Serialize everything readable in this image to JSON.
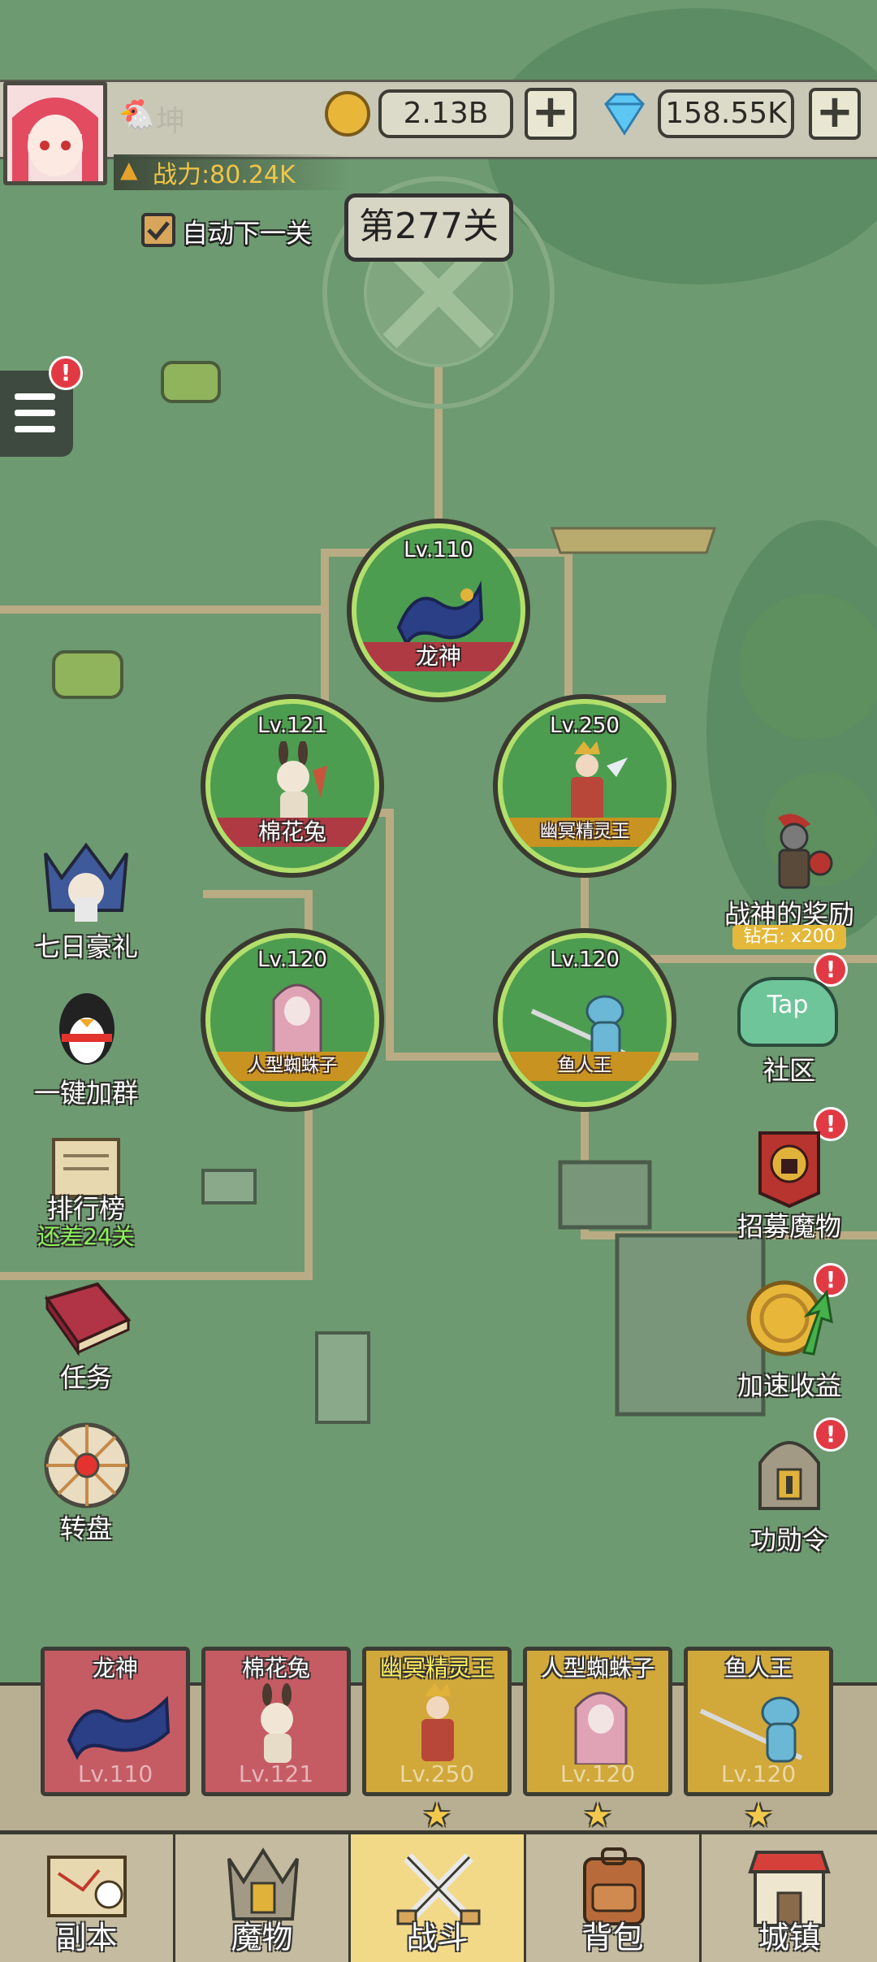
{
  "player": {
    "name": "坤",
    "power": "战力:80.24K",
    "gold": "2.13B",
    "diamonds": "158.55K"
  },
  "stage": {
    "auto_next_label": "自动下一关",
    "current": "第277关"
  },
  "formation": [
    {
      "level": "Lv.110",
      "name": "龙神",
      "banner": "red"
    },
    {
      "level": "Lv.121",
      "name": "棉花兔",
      "banner": "red"
    },
    {
      "level": "Lv.250",
      "name": "幽冥精灵王",
      "banner": "gold"
    },
    {
      "level": "Lv.120",
      "name": "人型蜘蛛子",
      "banner": "gold"
    },
    {
      "level": "Lv.120",
      "name": "鱼人王",
      "banner": "gold"
    }
  ],
  "left_menu": {
    "seven_day": "七日豪礼",
    "join_group": "一键加群",
    "ranking": "排行榜",
    "ranking_sub": "还差24关",
    "tasks": "任务",
    "wheel": "转盘"
  },
  "right_menu": {
    "war_god_reward": "战神的奖励",
    "war_god_sub": "钻石: x200",
    "community": "社区",
    "recruit": "招募魔物",
    "speed_up": "加速收益",
    "merit": "功勋令",
    "tap_logo": "Tap"
  },
  "team": [
    {
      "name": "龙神",
      "level": "Lv.110",
      "style": "red"
    },
    {
      "name": "棉花兔",
      "level": "Lv.121",
      "style": "red"
    },
    {
      "name": "幽冥精灵王",
      "level": "Lv.250",
      "style": "gold"
    },
    {
      "name": "人型蜘蛛子",
      "level": "Lv.120",
      "style": "gold"
    },
    {
      "name": "鱼人王",
      "level": "Lv.120",
      "style": "gold"
    }
  ],
  "nav": [
    {
      "label": "副本"
    },
    {
      "label": "魔物"
    },
    {
      "label": "战斗"
    },
    {
      "label": "背包"
    },
    {
      "label": "城镇"
    }
  ],
  "colors": {
    "map_green": "#6d9a70",
    "path": "#c2b48a",
    "active_tab": "#f2d988",
    "badge": "#e23a44"
  }
}
